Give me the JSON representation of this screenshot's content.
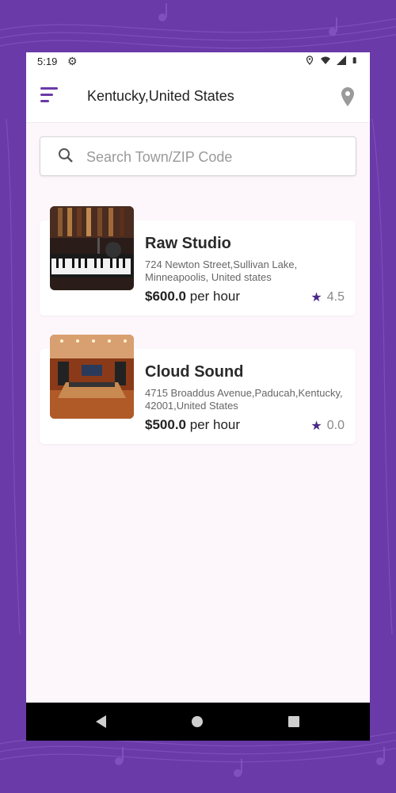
{
  "status": {
    "time": "5:19",
    "icons": [
      "gear-icon",
      "location-icon",
      "wifi-icon",
      "signal-icon",
      "battery-icon"
    ]
  },
  "appbar": {
    "location_title": "Kentucky,United States",
    "menu_icon": "menu-icon",
    "pin_icon": "location-pin-icon"
  },
  "search": {
    "placeholder": "Search Town/ZIP Code",
    "value": ""
  },
  "studios": [
    {
      "name": "Raw Studio",
      "address": "724 Newton Street,Sullivan Lake, Minneapoolis, United states",
      "price_amount": "$600.0",
      "price_unit": "per hour",
      "rating": "4.5"
    },
    {
      "name": "Cloud Sound",
      "address": "4715 Broaddus Avenue,Paducah,Kentucky, 42001,United States",
      "price_amount": "$500.0",
      "price_unit": "per hour",
      "rating": "0.0"
    }
  ],
  "colors": {
    "accent": "#6a3aa8",
    "star": "#4b2a86",
    "background": "#fdf6fb"
  }
}
